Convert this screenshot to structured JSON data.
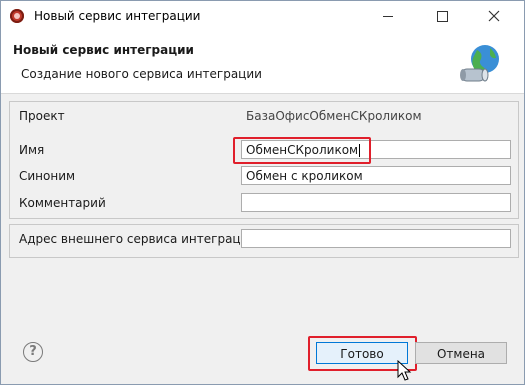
{
  "window": {
    "title": "Новый сервис интеграции"
  },
  "header": {
    "title": "Новый сервис интеграции",
    "subtitle": "Создание нового сервиса интеграции"
  },
  "form": {
    "project_label": "Проект",
    "project_value": "БазаОфисОбменСКроликом",
    "name_label": "Имя",
    "name_value": "ОбменСКроликом",
    "synonym_label": "Синоним",
    "synonym_value": "Обмен с кроликом",
    "comment_label": "Комментарий",
    "comment_value": "",
    "external_address_label": "Адрес внешнего сервиса интеграции",
    "external_address_value": ""
  },
  "buttons": {
    "ok": "Готово",
    "cancel": "Отмена",
    "help": "?"
  },
  "colors": {
    "highlight": "#e01f2b",
    "accent": "#0078d7"
  }
}
